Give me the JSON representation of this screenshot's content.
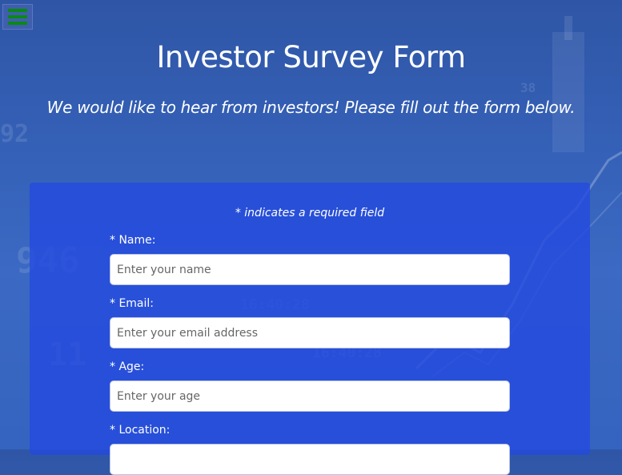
{
  "page": {
    "title": "Investor Survey Form",
    "subtitle": "We would like to hear from investors! Please fill out the form below."
  },
  "form": {
    "required_note": "* indicates a required field",
    "fields": [
      {
        "label": "* Name:",
        "placeholder": "Enter your name"
      },
      {
        "label": "* Email:",
        "placeholder": "Enter your email address"
      },
      {
        "label": "* Age:",
        "placeholder": "Enter your age"
      },
      {
        "label": "* Location:",
        "placeholder": ""
      }
    ]
  },
  "icons": {
    "menu": "hamburger-menu-icon"
  },
  "colors": {
    "menu_bars": "#0a8a12",
    "form_bg": "#2a4ade",
    "text": "#ffffff"
  }
}
